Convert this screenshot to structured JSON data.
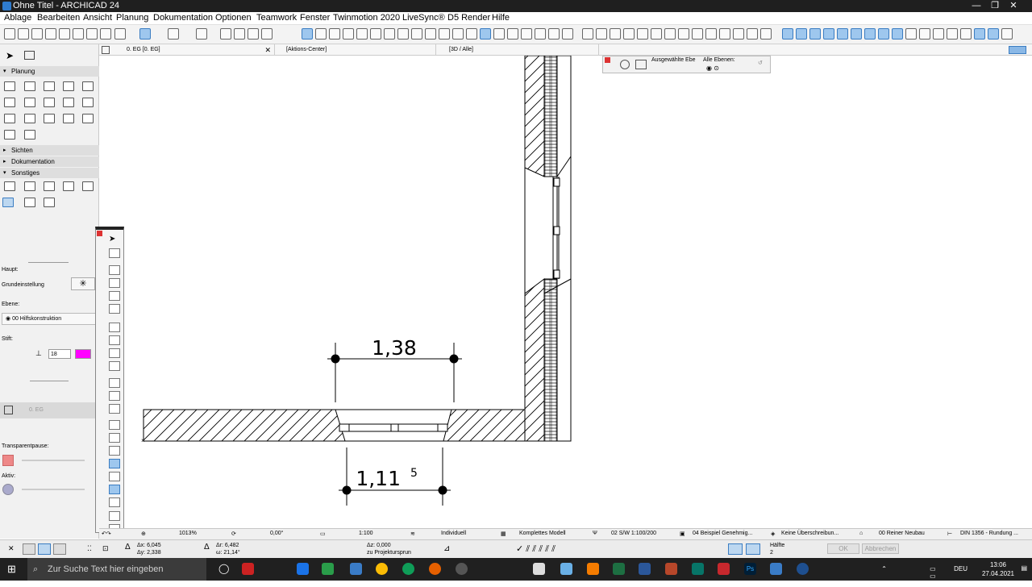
{
  "window": {
    "title": "Ohne Titel - ARCHICAD 24"
  },
  "menu": [
    "Ablage",
    "Bearbeiten",
    "Ansicht",
    "Planung",
    "Dokumentation",
    "Optionen",
    "Teamwork",
    "Fenster",
    "Twinmotion 2020",
    "LiveSync®",
    "D5 Render",
    "Hilfe"
  ],
  "tabs": {
    "floorplan": "0. EG [0. EG]",
    "action_center": "[Aktions-Center]",
    "view3d": "[3D / Alle]"
  },
  "left_panel": {
    "sections": {
      "planung": "Planung",
      "sichten": "Sichten",
      "dokumentation": "Dokumentation",
      "sonstiges": "Sonstiges"
    },
    "info": {
      "haupt": "Haupt:",
      "grundeinstellung": "Grundeinstellung",
      "ebene_label": "Ebene:",
      "ebene_value": "00 Hilfskonstruktion",
      "stift_label": "Stift:",
      "stift_value": "18",
      "floor": "0. EG",
      "transparent_label": "Transparentpause:",
      "aktiv_label": "Aktiv:"
    }
  },
  "layer_palette": {
    "selected": "Ausgewählte Ebe",
    "all": "Alle Ebenen:"
  },
  "drawing": {
    "dim_top": "1,38",
    "dim_bottom": "1,11",
    "dim_bottom_sup": "5"
  },
  "statusbar": {
    "zoom": "1013%",
    "angle": "0,00°",
    "scale": "1:100",
    "pen_set": "Individuell",
    "model": "Komplettes Modell",
    "model_view": "02 S/W 1:100/200",
    "layer_combo": "04 Beispiel Genehmig...",
    "override": "Keine Überschreibun...",
    "renovation": "00 Reiner Neubau",
    "dimension": "DIN 1356 - Rundung ..."
  },
  "coords": {
    "dx": "Δx: 6,045",
    "dy": "Δy: 2,338",
    "dr": "Δr: 6,482",
    "wa": "ω: 21,14°",
    "dz": "Δz: 0,000",
    "ref": "zu Projektursprun",
    "half_label": "Hälfte",
    "half_value": "2",
    "ok": "OK",
    "cancel": "Abbrechen"
  },
  "taskbar": {
    "search_placeholder": "Zur Suche Text hier eingeben",
    "lang": "DEU",
    "time": "13:06",
    "date": "27.04.2021"
  },
  "colors": {
    "titlebar": "#1f1f1f",
    "accent": "#3b7dc2",
    "taskbar": "#202020",
    "pen_magenta": "#ff00ff"
  }
}
